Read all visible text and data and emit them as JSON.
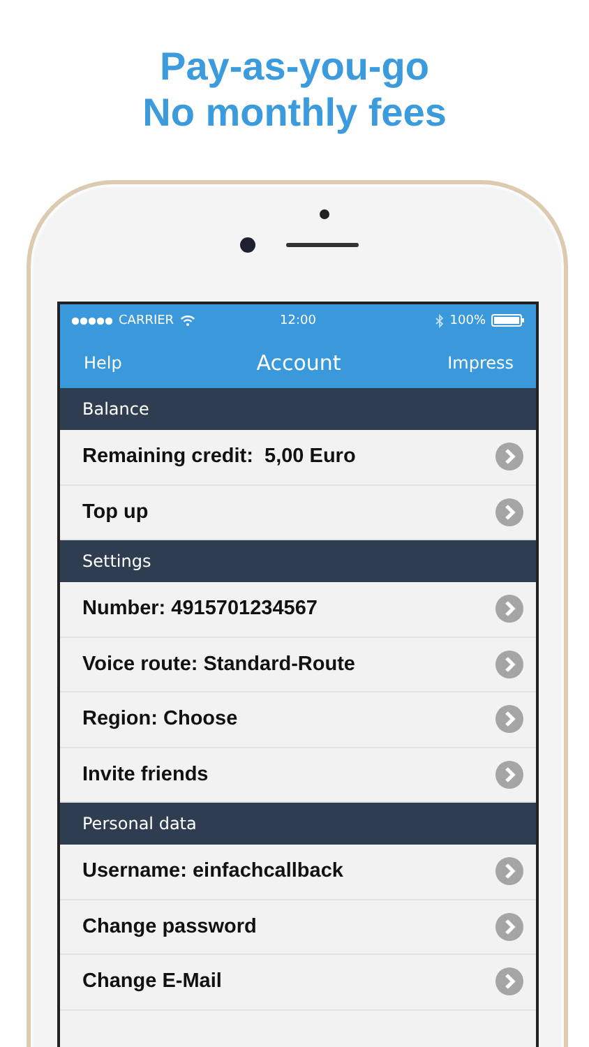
{
  "headline": [
    "Pay-as-you-go",
    "No monthly fees"
  ],
  "status_bar": {
    "carrier": "CARRIER",
    "time": "12:00",
    "battery": "100%"
  },
  "nav_bar": {
    "left": "Help",
    "title": "Account",
    "right": "Impress"
  },
  "sections": [
    {
      "title": "Balance",
      "rows": [
        {
          "label": "Remaining credit:  5,00 Euro"
        },
        {
          "label": "Top up"
        }
      ]
    },
    {
      "title": "Settings",
      "rows": [
        {
          "label": "Number: 4915701234567"
        },
        {
          "label": "Voice route: Standard-Route"
        },
        {
          "label": "Region: Choose"
        },
        {
          "label": "Invite friends"
        }
      ]
    },
    {
      "title": "Personal data",
      "rows": [
        {
          "label": "Username: einfachcallback"
        },
        {
          "label": "Change password"
        },
        {
          "label": "Change E-Mail"
        }
      ]
    }
  ]
}
